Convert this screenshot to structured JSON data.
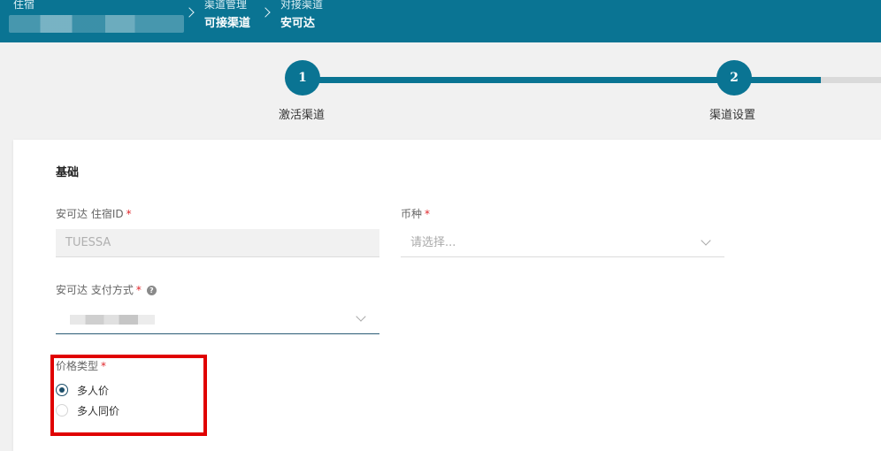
{
  "breadcrumb": {
    "root": {
      "small": "住宿"
    },
    "level2": {
      "small": "渠道管理",
      "big": "可接渠道"
    },
    "level3": {
      "small": "对接渠道",
      "big": "安可达"
    }
  },
  "steps": [
    {
      "number": "1",
      "label": "激活渠道"
    },
    {
      "number": "2",
      "label": "渠道设置"
    }
  ],
  "form": {
    "section_title": "基础",
    "property_id": {
      "label": "安可达 住宿ID",
      "required": "*",
      "value": "TUESSA"
    },
    "currency": {
      "label": "币种",
      "required": "*",
      "placeholder": "请选择..."
    },
    "payment": {
      "label": "安可达 支付方式",
      "required": "*",
      "help": "?"
    },
    "price_type": {
      "label": "价格类型",
      "required": "*",
      "options": [
        {
          "label": "多人价",
          "checked": true
        },
        {
          "label": "多人同价",
          "checked": false
        }
      ]
    }
  },
  "colors": {
    "header": "#0a7493",
    "highlight": "#e00000",
    "required": "#e0262b"
  }
}
